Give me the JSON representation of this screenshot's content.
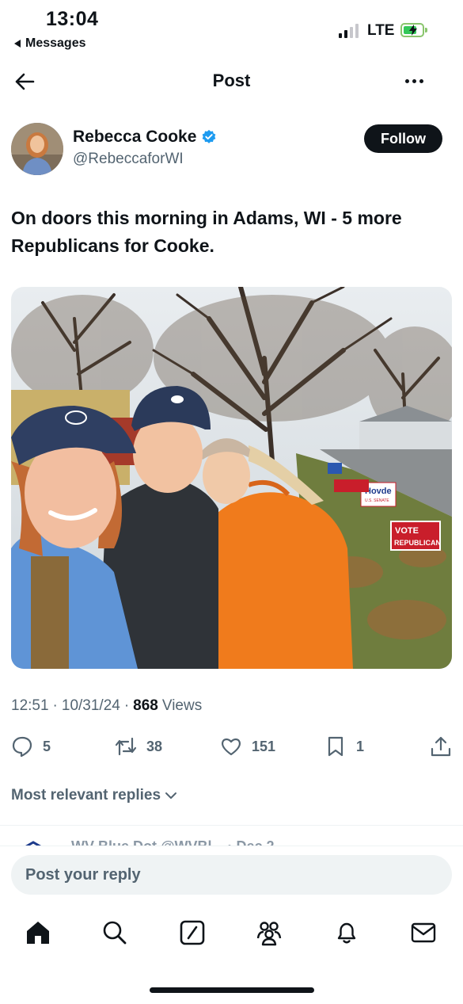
{
  "status_bar": {
    "time": "13:04",
    "back_app": "Messages",
    "network": "LTE",
    "signal_icon": "signal-bars-icon",
    "battery_icon": "battery-charging-icon"
  },
  "header": {
    "title": "Post",
    "back_icon": "back-arrow-icon",
    "more_icon": "more-icon"
  },
  "author": {
    "display_name": "Rebecca Cooke",
    "handle": "@RebeccaforWI",
    "verified_icon": "verified-badge-icon",
    "follow_label": "Follow"
  },
  "post": {
    "text": "On doors this morning in Adams, WI - 5 more Republicans for Cooke.",
    "photo_signs": {
      "vote_sign_line1": "VOTE",
      "vote_sign_line2": "REPUBLICAN",
      "hovde_sign": "Hovde",
      "hovde_sub": "U.S. SENATE"
    },
    "time": "12:51",
    "date": "10/31/24",
    "views_count": "868",
    "views_label": "Views"
  },
  "actions": {
    "replies": "5",
    "reposts": "38",
    "likes": "151",
    "bookmarks": "1"
  },
  "replies_filter": "Most relevant replies",
  "peek_text": "WV Blue Dot @WVBl... · Dec 2",
  "composer": {
    "placeholder": "Post your reply"
  },
  "colors": {
    "accent": "#1d9bf0",
    "text_primary": "#0f1419",
    "text_secondary": "#536471",
    "follow_bg": "#0f1419"
  }
}
